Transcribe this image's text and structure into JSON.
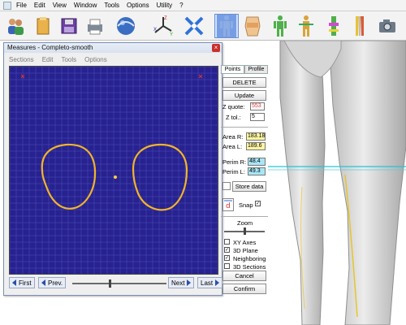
{
  "menubar": {
    "items": [
      "File",
      "Edit",
      "View",
      "Window",
      "Tools",
      "Options",
      "Utility",
      "?"
    ]
  },
  "toolbar": {
    "icons": [
      "users-icon",
      "folder-icon",
      "save-icon",
      "print-icon",
      "sphere-icon",
      "axes-icon",
      "crosshair-icon",
      "body-icon",
      "torso-icon",
      "mannequin-icon",
      "body-measure-icon",
      "leg-icon",
      "legs-icon",
      "camera-icon"
    ],
    "selected": "body-icon"
  },
  "dialog": {
    "title": "Measures - Completo-smooth",
    "close_label": "×",
    "menu": [
      "Sections",
      "Edit",
      "Tools",
      "Options"
    ],
    "nav": {
      "first": "First",
      "prev": "Prev.",
      "next": "Next",
      "last": "Last",
      "position": 0.4
    },
    "plot_colors": {
      "background": "#27228f",
      "grid": "#4a4fbf",
      "contour": "#f2b428",
      "center": "#ffd03a"
    }
  },
  "panel": {
    "tabs": [
      "Points",
      "Profile"
    ],
    "delete_label": "DELETE",
    "update_label": "Update",
    "z_quote_label": "Z quote:",
    "z_quote_value": "553",
    "z_tol_label": "Z tol.:",
    "z_tol_value": "5",
    "area_r_label": "Area R:",
    "area_r_value": "183.18",
    "area_l_label": "Area L:",
    "area_l_value": "189.6",
    "perim_r_label": "Perim R:",
    "perim_r_value": "48.4",
    "perim_l_label": "Perim L:",
    "perim_l_value": "49.3",
    "store_label": "Store data",
    "snap_label": "Snap",
    "snap_checked": true,
    "zoom_label": "Zoom",
    "zoom_level": 0.5,
    "options": [
      {
        "label": "XY Axes",
        "checked": false
      },
      {
        "label": "3D Plane",
        "checked": true
      },
      {
        "label": "Neighboring",
        "checked": true
      },
      {
        "label": "3D Sections",
        "checked": false
      }
    ],
    "cancel_label": "Cancel",
    "confirm_label": "Confirm"
  }
}
